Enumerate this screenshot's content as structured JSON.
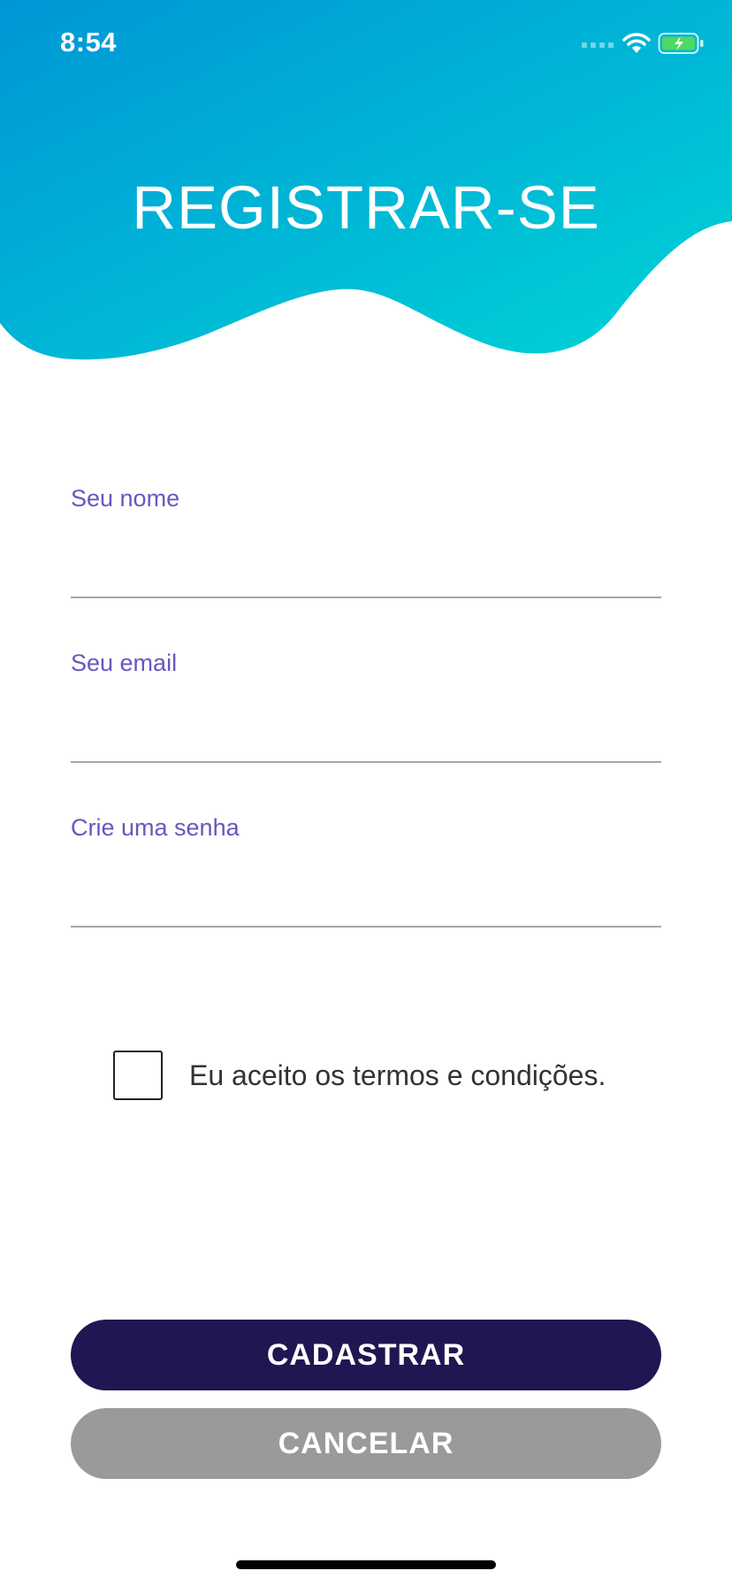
{
  "status_bar": {
    "time": "8:54",
    "icons": [
      "signal-icon",
      "wifi-icon",
      "battery-charging-icon"
    ]
  },
  "header": {
    "title": "REGISTRAR-SE",
    "gradient": [
      "#0096d6",
      "#00d4d6"
    ]
  },
  "form": {
    "fields": [
      {
        "label": "Seu nome",
        "value": "",
        "placeholder": ""
      },
      {
        "label": "Seu email",
        "value": "",
        "placeholder": ""
      },
      {
        "label": "Crie uma senha",
        "value": "",
        "placeholder": ""
      }
    ],
    "label_color": "#6b55c0",
    "terms": {
      "label": "Eu aceito os termos e condições.",
      "checked": false
    }
  },
  "actions": {
    "submit_label": "CADASTRAR",
    "cancel_label": "CANCELAR",
    "submit_color": "#201652",
    "cancel_color": "#9a9a9a"
  }
}
